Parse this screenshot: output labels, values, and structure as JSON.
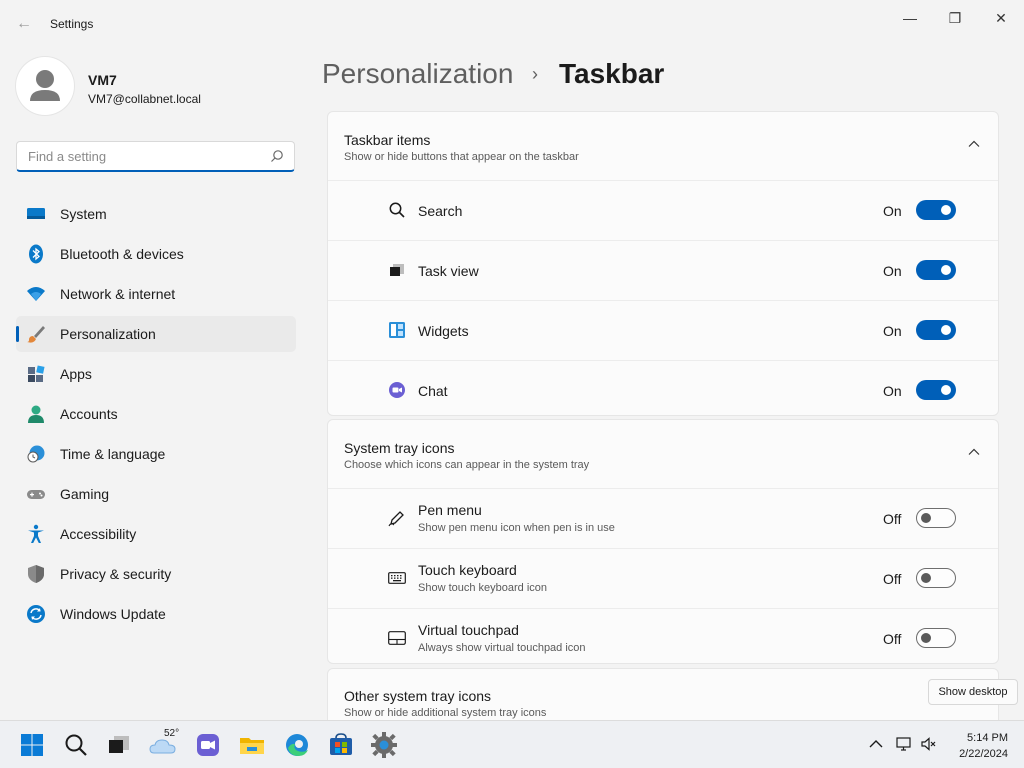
{
  "window": {
    "app_title": "Settings",
    "minimize": "—",
    "maximize": "❐",
    "close": "✕",
    "back": "←"
  },
  "user": {
    "name": "VM7",
    "email": "VM7@collabnet.local"
  },
  "search": {
    "placeholder": "Find a setting"
  },
  "nav": [
    {
      "label": "System",
      "icon": "system-icon"
    },
    {
      "label": "Bluetooth & devices",
      "icon": "bluetooth-icon"
    },
    {
      "label": "Network & internet",
      "icon": "wifi-icon"
    },
    {
      "label": "Personalization",
      "icon": "brush-icon",
      "active": true
    },
    {
      "label": "Apps",
      "icon": "apps-icon"
    },
    {
      "label": "Accounts",
      "icon": "account-icon"
    },
    {
      "label": "Time & language",
      "icon": "clock-globe-icon"
    },
    {
      "label": "Gaming",
      "icon": "gamepad-icon"
    },
    {
      "label": "Accessibility",
      "icon": "accessibility-icon"
    },
    {
      "label": "Privacy & security",
      "icon": "shield-icon"
    },
    {
      "label": "Windows Update",
      "icon": "update-icon"
    }
  ],
  "header": {
    "parent": "Personalization",
    "separator": "›",
    "current": "Taskbar"
  },
  "taskbar_items": {
    "title": "Taskbar items",
    "subtitle": "Show or hide buttons that appear on the taskbar",
    "rows": [
      {
        "label": "Search",
        "state": "On",
        "on": true,
        "icon": "search-icon"
      },
      {
        "label": "Task view",
        "state": "On",
        "on": true,
        "icon": "task-view-icon"
      },
      {
        "label": "Widgets",
        "state": "On",
        "on": true,
        "icon": "widgets-icon"
      },
      {
        "label": "Chat",
        "state": "On",
        "on": true,
        "icon": "chat-icon"
      }
    ]
  },
  "system_tray": {
    "title": "System tray icons",
    "subtitle": "Choose which icons can appear in the system tray",
    "rows": [
      {
        "label": "Pen menu",
        "sub": "Show pen menu icon when pen is in use",
        "state": "Off",
        "on": false,
        "icon": "pen-icon"
      },
      {
        "label": "Touch keyboard",
        "sub": "Show touch keyboard icon",
        "state": "Off",
        "on": false,
        "icon": "keyboard-icon"
      },
      {
        "label": "Virtual touchpad",
        "sub": "Always show virtual touchpad icon",
        "state": "Off",
        "on": false,
        "icon": "touchpad-icon"
      }
    ]
  },
  "other_tray": {
    "title": "Other system tray icons",
    "subtitle": "Show or hide additional system tray icons"
  },
  "tooltip": "Show desktop",
  "taskbar": {
    "weather_temp": "52°",
    "time": "5:14 PM",
    "date": "2/22/2024"
  },
  "colors": {
    "accent": "#005fb8",
    "background": "#f3f3f3",
    "card": "#fbfbfb"
  }
}
